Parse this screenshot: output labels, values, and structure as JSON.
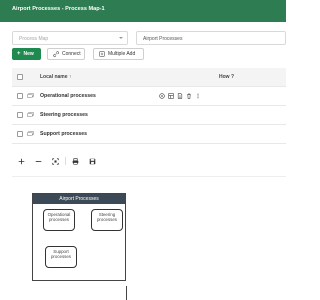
{
  "header": {
    "title": "Airport Processes - Process Map-1"
  },
  "filters": {
    "process_map_placeholder": "Process Map",
    "selected_value": "Airport Processes"
  },
  "toolbar": {
    "new_label": "New",
    "connect_label": "Connect",
    "multiple_add_label": "Multiple Add"
  },
  "table": {
    "columns": {
      "name": "Local name",
      "sort_indicator": "↑",
      "how": "How ?"
    },
    "rows": [
      {
        "name": "Operational processes"
      },
      {
        "name": "Steering processes"
      },
      {
        "name": "Support processes"
      }
    ]
  },
  "diagram": {
    "title": "Airport Processes",
    "nodes": {
      "operational": "Operational processes",
      "steering": "Steering processes",
      "support": "Support processes"
    }
  },
  "colors": {
    "header": "#2e7d52",
    "primary_button": "#1f8a50",
    "diagram_title": "#3b4a56"
  }
}
